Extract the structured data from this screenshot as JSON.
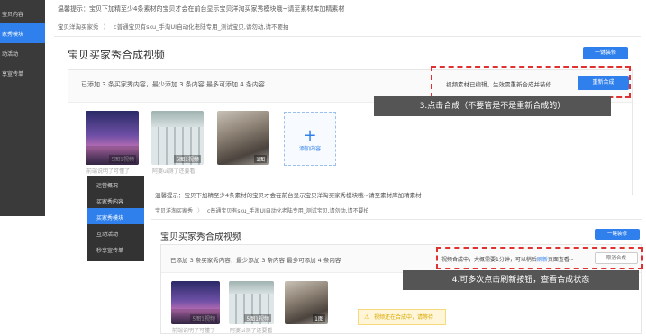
{
  "screen1": {
    "sidebar": [
      "宝贝内容",
      "家秀模块",
      "动活动",
      "享宣传单"
    ],
    "tip_label": "温馨提示：",
    "tip_text": "宝贝下加精至少4条素材的宝贝才会在前台显示宝贝洋淘买家秀模块哦~请至素材库加精素材",
    "breadcrumb": [
      "宝贝洋淘买家秀",
      "c普通宝贝有sku_手淘UI自动化老陆专用_测试宝贝,请勿动,请不要拍"
    ],
    "title": "宝贝买家秀合成视频",
    "one_key_button": "一键装修",
    "added_text": "已添加 3 条买家秀内容，最少添加 3 条内容 最多可添加 4 条内容",
    "edited_text": "视频素材已编辑，生效需重新合成并装修",
    "regen_button": "重新合成",
    "annotation": "3.点击合成（不要管是不是重新合成的）",
    "thumbs": [
      {
        "caption": "5图1视频",
        "label": "前端说明了可懂了"
      },
      {
        "caption": "5图1视频",
        "label": "阿婆ui测了还要看"
      },
      {
        "caption": "1图",
        "label": ""
      }
    ],
    "add_text": "添加内容"
  },
  "screen2": {
    "menu": [
      "运营概况",
      "买家秀内容",
      "买家秀模块",
      "互动活动",
      "秒享宣传单"
    ],
    "tip_label": "温馨提示：",
    "tip_text": "宝贝下加精至少4条素材的宝贝才会在前台显示宝贝洋淘买家秀模块哦~请至素材库加精素材",
    "breadcrumb": [
      "宝贝洋淘买家秀",
      "c普通宝贝有sku_手淘UI自动化老陆专用_测试宝贝,请勿动,请不要拍"
    ],
    "title": "宝贝买家秀合成视频",
    "one_key_button": "一键装修",
    "added_text": "已添加 3 条买家秀内容，最少添加 3 条内容 最多可添加 4 条内容",
    "synth_text_a": "视频合成中，大概需要1分钟，可以稍后",
    "synth_link": "刷新",
    "synth_text_b": "页面查看~",
    "cancel_button": "取消合成",
    "annotation": "4.可多次点击刷新按钮，查看合成状态",
    "thumbs": [
      {
        "caption": "5图1视频",
        "label": "前端说明了可懂了"
      },
      {
        "caption": "5图1视频",
        "label": "阿婆ui测了还要看"
      },
      {
        "caption": "1图",
        "label": ""
      }
    ],
    "warning": "视频还在合成中，请等待"
  }
}
